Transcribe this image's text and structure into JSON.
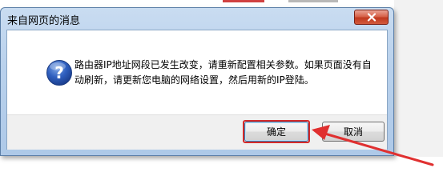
{
  "dialog": {
    "title": "来自网页的消息",
    "message_line1": "路由器IP地址网段已发生改变，请重新配置相关参数。如果页面没有自",
    "message_line2": "动刷新，请更新您电脑的网络设置，然后用新的IP登陆。",
    "icon": "question-icon",
    "buttons": {
      "ok_label": "确定",
      "cancel_label": "取消"
    }
  },
  "colors": {
    "highlight": "#d42a2a",
    "close_button": "#c0391f",
    "titlebar": "#b9d1ec"
  }
}
